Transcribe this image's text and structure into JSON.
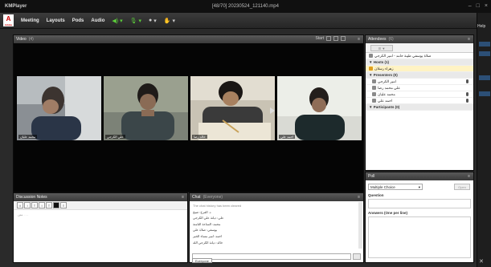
{
  "window": {
    "app_title": "KMPlayer",
    "file_title": "[48/70] 20230524_121140.mp4",
    "controls": [
      "–",
      "□",
      "×"
    ]
  },
  "menubar": {
    "logo_text": "A",
    "logo_sub": "Adobe",
    "items": [
      "Meeting",
      "Layouts",
      "Pods",
      "Audio"
    ],
    "controls": [
      {
        "icon": "speaker-icon",
        "glyph": "◀)",
        "color": "#5ccf3a"
      },
      {
        "icon": "microphone-icon",
        "glyph": "🎙",
        "color": "#5ccf3a"
      },
      {
        "icon": "webcam-icon",
        "glyph": "●",
        "color": "#cccccc"
      },
      {
        "icon": "raise-hand-icon",
        "glyph": "✋",
        "color": "#cccccc"
      }
    ]
  },
  "right_strip": {
    "help_label": "Help"
  },
  "video_pod": {
    "title": "Video",
    "count": "(4)",
    "start_label": "Start",
    "tiles": [
      {
        "name": "محمد عليان"
      },
      {
        "name": "علي الكرجي"
      },
      {
        "name": "خالد رضا"
      },
      {
        "name": "احمد علي"
      }
    ]
  },
  "attendees_pod": {
    "title": "Attendees",
    "count": "(6)",
    "toolbar_btn": "☰ ▼",
    "rows": [
      {
        "text": "صلاة يوسفي طيبة حامد - امير الكرجي",
        "type": "item",
        "icon": true,
        "mic": false
      },
      {
        "text": "▼ Hosts (1)",
        "type": "section",
        "icon": false,
        "mic": false
      },
      {
        "text": "زهراء رسلان",
        "type": "highlight",
        "icon": true,
        "mic": false
      },
      {
        "text": "▼ Presenters (0)",
        "type": "section",
        "icon": false,
        "mic": false
      },
      {
        "text": "امير الكرجي",
        "type": "indent",
        "icon": true,
        "mic": true
      },
      {
        "text": "علي محمد رضا",
        "type": "indent",
        "icon": true,
        "mic": false
      },
      {
        "text": "محمد عليان",
        "type": "indent",
        "icon": true,
        "mic": true
      },
      {
        "text": "احمد علي",
        "type": "indent",
        "icon": true,
        "mic": true
      },
      {
        "text": "▼ Participants (0)",
        "type": "section",
        "icon": false,
        "mic": false
      }
    ]
  },
  "poll_pod": {
    "title": "Poll",
    "select_value": "Multiple Choice",
    "open_label": "Open",
    "question_label": "Question",
    "answers_label": "Answers (One per line)"
  },
  "notes_pod": {
    "title": "Discussion Notes",
    "toolbar": [
      "I↕",
      "↕",
      "T",
      "I",
      "T",
      "■",
      "≡"
    ],
    "body": "متن . . ."
  },
  "chat_pod": {
    "title": "Chat",
    "subtitle": "(Everyone)",
    "lines": [
      {
        "text": "The chat history has been cleared",
        "note": true
      },
      {
        "text": "د. الفرح: صبح",
        "note": false
      },
      {
        "text": "علي: ديانة علي الكرجي",
        "note": false
      },
      {
        "text": "محمد: الساعة الثامنة",
        "note": false
      },
      {
        "text": "يوسفي: صلاة علي",
        "note": false
      },
      {
        "text": "احمد: امير مساء الخير",
        "note": false
      },
      {
        "text": "خالد: ديانة الكرجي الله",
        "note": false
      }
    ],
    "tab_label": "Everyone"
  },
  "colors": {
    "accent_green": "#5ccf3a",
    "highlight_row": "#fff3c4",
    "strip_blue": "#2c4f76"
  }
}
